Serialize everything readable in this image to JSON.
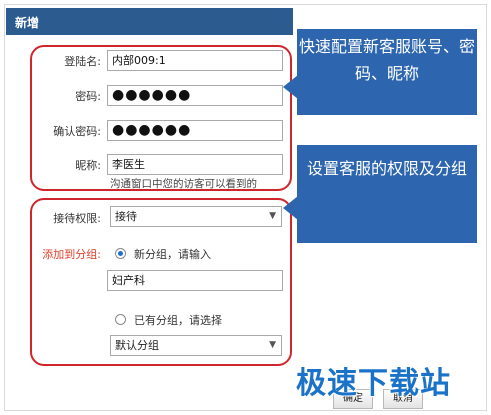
{
  "dialog": {
    "title": "新增"
  },
  "form": {
    "login_label": "登陆名:",
    "login_value": "内部009:1",
    "password_label": "密码:",
    "password_value": "●●●●●●",
    "confirm_label": "确认密码:",
    "confirm_value": "●●●●●●",
    "nickname_label": "昵称:",
    "nickname_value": "李医生",
    "nickname_hint": "沟通窗口中您的访客可以看到的",
    "permission_label": "接待权限:",
    "permission_value": "接待",
    "group_label": "添加到分组:",
    "new_group_option": "新分组，请输入",
    "new_group_value": "妇产科",
    "existing_group_option": "已有分组，请选择",
    "existing_group_value": "默认分组"
  },
  "callouts": {
    "top": "快速配置新客服账号、密码、昵称",
    "bottom": "设置客服的权限及分组"
  },
  "buttons": {
    "ok": "确定",
    "cancel": "取消"
  },
  "watermark": "极速下载站",
  "colors": {
    "header": "#2c5b8f",
    "callout": "#2d66ae",
    "outline": "#d0262b",
    "watermark": "#1a73c8"
  },
  "icons": {
    "select_caret": "chevron-down-icon",
    "radio": "radio-icon"
  }
}
